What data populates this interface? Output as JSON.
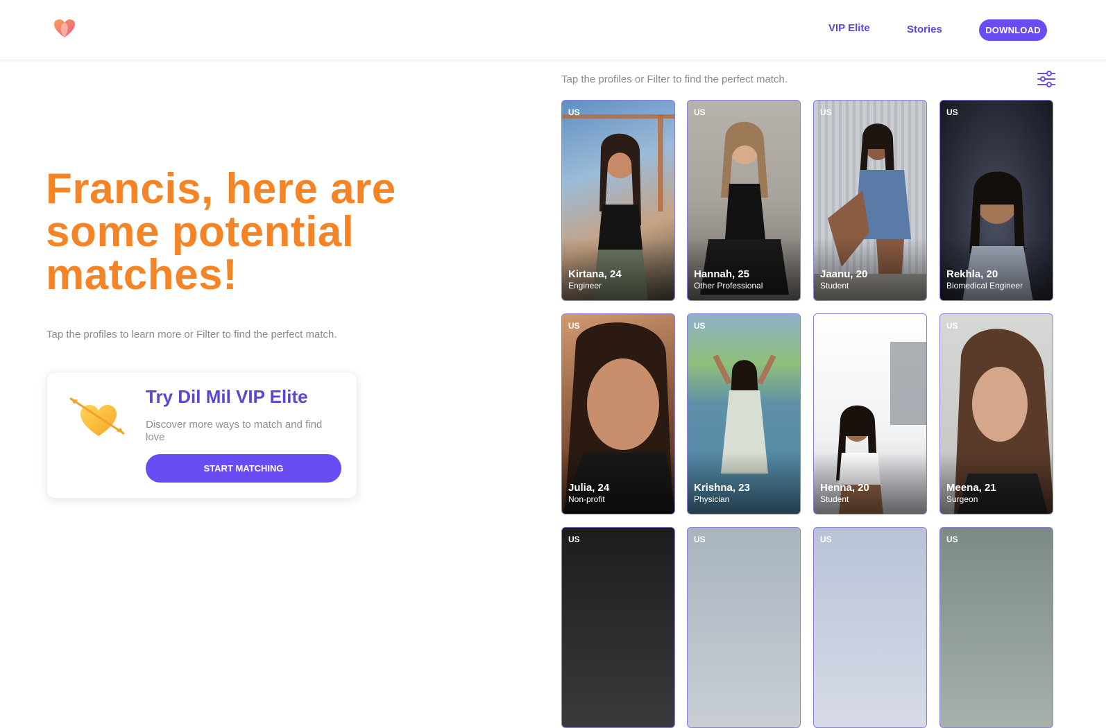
{
  "nav": {
    "vip_label": "VIP Elite",
    "stories_label": "Stories",
    "download_label": "DOWNLOAD"
  },
  "hero": {
    "headline": "Francis, here are some potential matches!",
    "subtext": "Tap the profiles to learn more or Filter to find the perfect match."
  },
  "vip_card": {
    "title": "Try Dil Mil VIP Elite",
    "description": "Discover more ways to match and find love",
    "button_label": "START MATCHING"
  },
  "grid": {
    "hint": "Tap the profiles or Filter to find the perfect match.",
    "profiles": [
      {
        "country": "US",
        "name": "Kirtana, 24",
        "job": "Engineer"
      },
      {
        "country": "US",
        "name": "Hannah, 25",
        "job": "Other Professional"
      },
      {
        "country": "US",
        "name": "Jaanu, 20",
        "job": "Student"
      },
      {
        "country": "US",
        "name": "Rekhla, 20",
        "job": "Biomedical Engineer"
      },
      {
        "country": "US",
        "name": "Julia, 24",
        "job": "Non-profit"
      },
      {
        "country": "US",
        "name": "Krishna, 23",
        "job": "Physician"
      },
      {
        "country": "",
        "name": "Henna, 20",
        "job": "Student"
      },
      {
        "country": "US",
        "name": "Meena, 21",
        "job": "Surgeon"
      },
      {
        "country": "US",
        "name": "",
        "job": ""
      },
      {
        "country": "US",
        "name": "",
        "job": ""
      },
      {
        "country": "US",
        "name": "",
        "job": ""
      },
      {
        "country": "US",
        "name": "",
        "job": ""
      }
    ]
  },
  "colors": {
    "accent": "#6a4cf5",
    "headline": "#f58426",
    "nav_text": "#5b45d6"
  }
}
